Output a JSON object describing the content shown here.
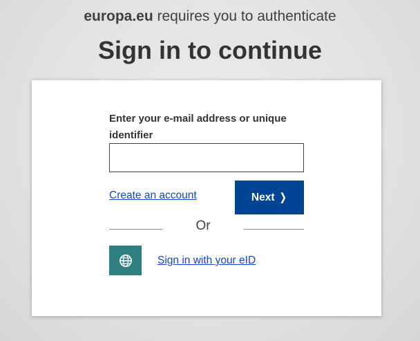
{
  "header": {
    "domain": "europa.eu",
    "auth_message": " requires you to authenticate",
    "title": "Sign in to continue"
  },
  "form": {
    "email_label": "Enter your e-mail address or unique identifier",
    "email_value": "",
    "email_placeholder": "",
    "create_account_label": "Create an account",
    "next_label": "Next",
    "next_icon": "chevron-right-icon",
    "or_label": "Or",
    "eid_icon": "globe-icon",
    "eid_label": "Sign in with your eID"
  },
  "colors": {
    "primary_button": "#004494",
    "link": "#0e47cb",
    "eid_button": "#2e7f7f",
    "text": "#333333"
  }
}
